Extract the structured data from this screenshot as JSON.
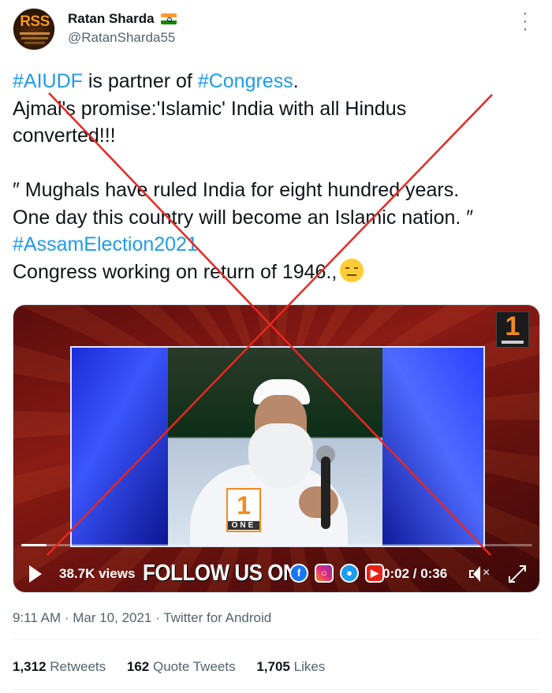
{
  "user": {
    "name": "Ratan Sharda",
    "handle": "@RatanSharda55",
    "avatar_text": "RSS"
  },
  "tweet": {
    "line1": [
      {
        "text": "#AIUDF",
        "tag": true
      },
      {
        "text": " is partner of ",
        "tag": false
      },
      {
        "text": "#Congress",
        "tag": true
      },
      {
        "text": ".",
        "tag": false
      }
    ],
    "line2": "Ajmal's promise:'Islamic' India with all Hindus",
    "line3": "converted!!!",
    "line4": "″ Mughals have ruled India for eight hundred years.",
    "line5": "One day this country will become an Islamic nation. ″",
    "line6_tag": "#AssamElection2021",
    "line7": "Congress working on return of 1946.,"
  },
  "video": {
    "views": "38.7K views",
    "banner": "FOLLOW US ON",
    "time": "0:02 / 0:36",
    "progress": 0.05,
    "channel_logo": "1",
    "channel_word": "ONE",
    "social_icons": [
      "facebook-icon",
      "instagram-icon",
      "twitter-icon",
      "youtube-icon"
    ]
  },
  "meta": {
    "timestamp": "9:11 AM · Mar 10, 2021 · Twitter for Android"
  },
  "stats": {
    "retweets_num": "1,312",
    "retweets_label": "Retweets",
    "quotes_num": "162",
    "quotes_label": "Quote Tweets",
    "likes_num": "1,705",
    "likes_label": "Likes"
  },
  "colors": {
    "link": "#1d9bf0",
    "muted": "#536471",
    "cross": "#e8271f"
  }
}
